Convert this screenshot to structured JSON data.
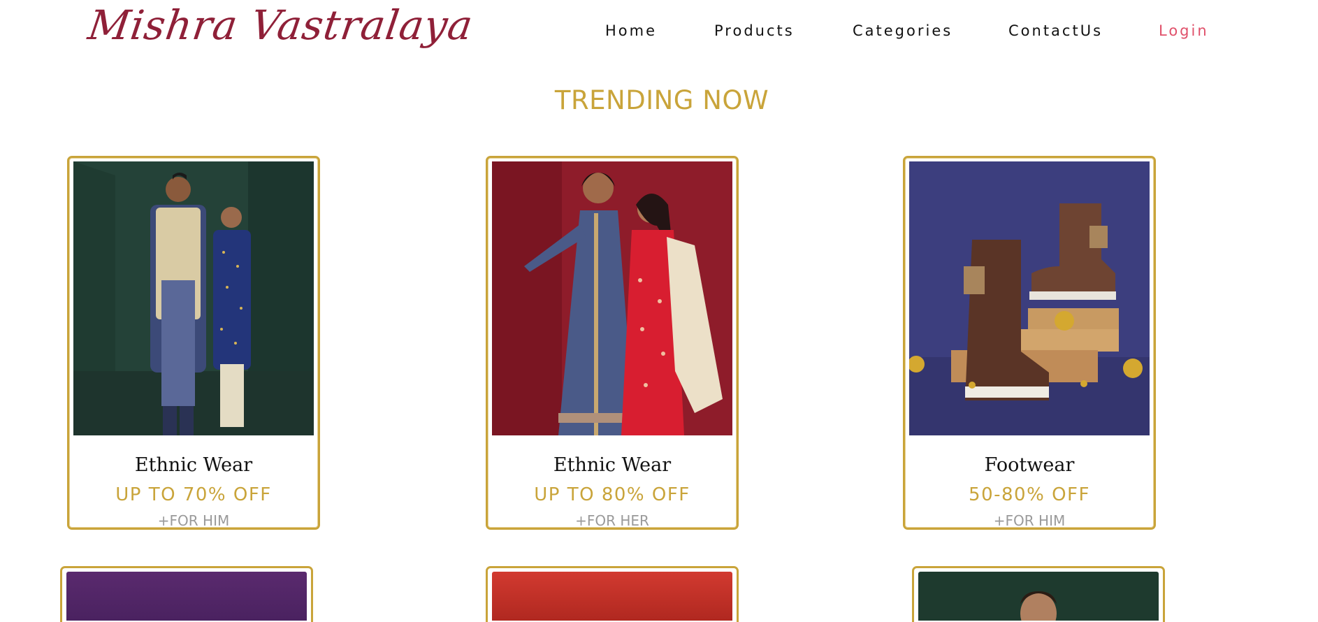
{
  "header": {
    "logo_text": "Mishra Vastralaya",
    "nav": [
      {
        "label": "Home"
      },
      {
        "label": "Products"
      },
      {
        "label": "Categories"
      },
      {
        "label": "ContactUs"
      },
      {
        "label": "Login"
      }
    ]
  },
  "section": {
    "title": "TRENDING NOW"
  },
  "cards": [
    {
      "title": "Ethnic Wear",
      "offer": "UP TO 70% OFF",
      "sub": "+FOR HIM"
    },
    {
      "title": "Ethnic Wear",
      "offer": "UP TO 80% OFF",
      "sub": "+FOR HER"
    },
    {
      "title": "Footwear",
      "offer": "50-80% OFF",
      "sub": "+FOR HIM"
    }
  ],
  "colors": {
    "brand": "#8f2038",
    "accent_gold": "#c9a43a",
    "login": "#e0506a"
  }
}
